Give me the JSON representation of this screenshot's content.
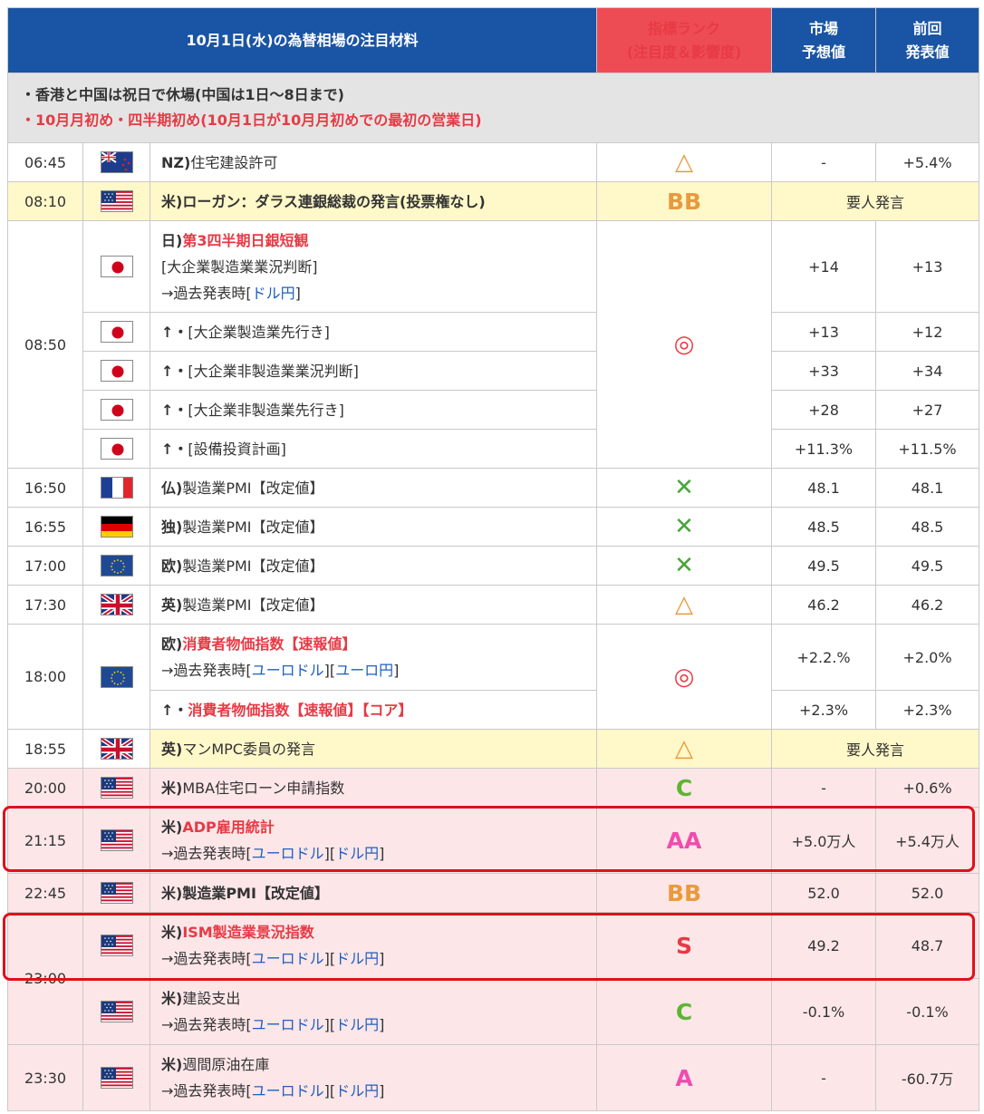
{
  "header": {
    "title": "10月1日(水)の為替相場の注目材料",
    "rank_line1": "指標ランク",
    "rank_line2": "(注目度＆影響度)",
    "forecast_line1": "市場",
    "forecast_line2": "予想値",
    "previous_line1": "前回",
    "previous_line2": "発表値"
  },
  "notice": {
    "line1": "・香港と中国は祝日で休場(中国は1日～8日まで)",
    "line2": "・10月月初め・四半期初め(10月1日が10月月初めでの最初の営業日)"
  },
  "rows": [
    {
      "time": "06:45",
      "prefix": "NZ)",
      "title": "住宅建設許可",
      "rank": "△",
      "forecast": "-",
      "previous": "+5.4%"
    },
    {
      "time": "08:10",
      "prefix": "米)",
      "title": "ローガン：ダラス連銀総裁の発言(投票権なし)",
      "rank": "BB",
      "speech": "要人発言"
    },
    {
      "time": "08:50",
      "prefix": "日)",
      "title": "第3四半期日銀短観",
      "sub": "[大企業製造業業況判断]",
      "past_label": "→過去発表時[",
      "link1": "ドル円",
      "close": "]",
      "rank": "◎",
      "forecast": "+14",
      "previous": "+13"
    },
    {
      "arrow": "↑・",
      "title": "[大企業製造業先行き]",
      "forecast": "+13",
      "previous": "+12"
    },
    {
      "arrow": "↑・",
      "title": "[大企業非製造業業況判断]",
      "forecast": "+33",
      "previous": "+34"
    },
    {
      "arrow": "↑・",
      "title": "[大企業非製造業先行き]",
      "forecast": "+28",
      "previous": "+27"
    },
    {
      "arrow": "↑・",
      "title": "[設備投資計画]",
      "forecast": "+11.3%",
      "previous": "+11.5%"
    },
    {
      "time": "16:50",
      "prefix": "仏)",
      "title": "製造業PMI【改定値】",
      "rank": "✕",
      "forecast": "48.1",
      "previous": "48.1"
    },
    {
      "time": "16:55",
      "prefix": "独)",
      "title": "製造業PMI【改定値】",
      "rank": "✕",
      "forecast": "48.5",
      "previous": "48.5"
    },
    {
      "time": "17:00",
      "prefix": "欧)",
      "title": "製造業PMI【改定値】",
      "rank": "✕",
      "forecast": "49.5",
      "previous": "49.5"
    },
    {
      "time": "17:30",
      "prefix": "英)",
      "title": "製造業PMI【改定値】",
      "rank": "△",
      "forecast": "46.2",
      "previous": "46.2"
    },
    {
      "time": "18:00",
      "prefix": "欧)",
      "title": "消費者物価指数【速報値】",
      "past_label": "→過去発表時[",
      "link1": "ユーロドル",
      "mid": "][",
      "link2": "ユーロ円",
      "close": "]",
      "rank": "◎",
      "forecast": "+2.2.%",
      "previous": "+2.0%"
    },
    {
      "arrow": "↑・",
      "title": "消費者物価指数【速報値】【コア】",
      "forecast": "+2.3%",
      "previous": "+2.3%"
    },
    {
      "time": "18:55",
      "prefix": "英)",
      "title": "マンMPC委員の発言",
      "rank": "△",
      "speech": "要人発言"
    },
    {
      "time": "20:00",
      "prefix": "米)",
      "title": "MBA住宅ローン申請指数",
      "rank": "C",
      "forecast": "-",
      "previous": "+0.6%"
    },
    {
      "time": "21:15",
      "prefix": "米)",
      "title": "ADP雇用統計",
      "past_label": "→過去発表時[",
      "link1": "ユーロドル",
      "mid": "][",
      "link2": "ドル円",
      "close": "]",
      "rank": "AA",
      "forecast": "+5.0万人",
      "previous": "+5.4万人"
    },
    {
      "time": "22:45",
      "prefix": "米)",
      "title": "製造業PMI【改定値】",
      "rank": "BB",
      "forecast": "52.0",
      "previous": "52.0"
    },
    {
      "time": "23:00",
      "prefix": "米)",
      "title": "ISM製造業景況指数",
      "past_label": "→過去発表時[",
      "link1": "ユーロドル",
      "mid": "][",
      "link2": "ドル円",
      "close": "]",
      "rank": "S",
      "forecast": "49.2",
      "previous": "48.7"
    },
    {
      "prefix": "米)",
      "title": "建設支出",
      "past_label": "→過去発表時[",
      "link1": "ユーロドル",
      "mid": "][",
      "link2": "ドル円",
      "close": "]",
      "rank": "C",
      "forecast": "-0.1%",
      "previous": "-0.1%"
    },
    {
      "time": "23:30",
      "prefix": "米)",
      "title": "週間原油在庫",
      "past_label": "→過去発表時[",
      "link1": "ユーロドル",
      "mid": "][",
      "link2": "ドル円",
      "close": "]",
      "rank": "A",
      "forecast": "-",
      "previous": "-60.7万"
    }
  ],
  "colors": {
    "header_blue": "#1a54a4",
    "header_red": "#ee4c55",
    "highlight_box": "#e0101a",
    "red_text": "#e73a45",
    "link_blue": "#1f5fbf",
    "pink_row": "#fde6e8",
    "yellow_row": "#fff8c9"
  }
}
